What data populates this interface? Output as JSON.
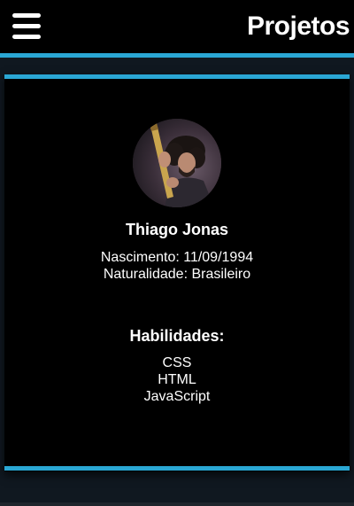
{
  "header": {
    "title": "Projetos",
    "menu_icon": "hamburger-menu-icon",
    "accent_color": "#2aa7d4"
  },
  "profile": {
    "name": "Thiago Jonas",
    "birth": "Nascimento: 11/09/1994",
    "origin": "Naturalidade: Brasileiro"
  },
  "skills": {
    "title": "Habilidades:",
    "items": [
      "CSS",
      "HTML",
      "JavaScript"
    ]
  }
}
